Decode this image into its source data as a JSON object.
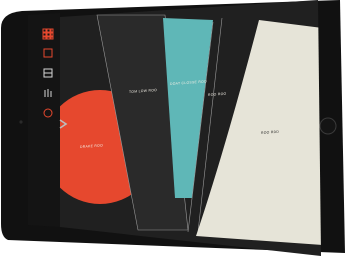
{
  "app": {
    "toolbar": {
      "items": [
        {
          "name": "grid-icon"
        },
        {
          "name": "square-icon"
        },
        {
          "name": "split-square-icon"
        },
        {
          "name": "bars-icon"
        },
        {
          "name": "circle-icon"
        }
      ],
      "expand_icon": "chevron-right-icon"
    },
    "labels": {
      "left_segment": "DRAKE ROO",
      "second_segment": "TOM LOW ROO",
      "teal_segment": "DOAT CLOSSE ROO",
      "fourth_segment": "ROO ROO",
      "cream_segment": "ROO RDD"
    },
    "colors": {
      "accent_red": "#e6482e",
      "accent_teal": "#5fb7b7",
      "accent_cream": "#e6e4d8",
      "device_black": "#111111",
      "screen_bg": "#202020",
      "line": "#9a9a9a"
    }
  }
}
